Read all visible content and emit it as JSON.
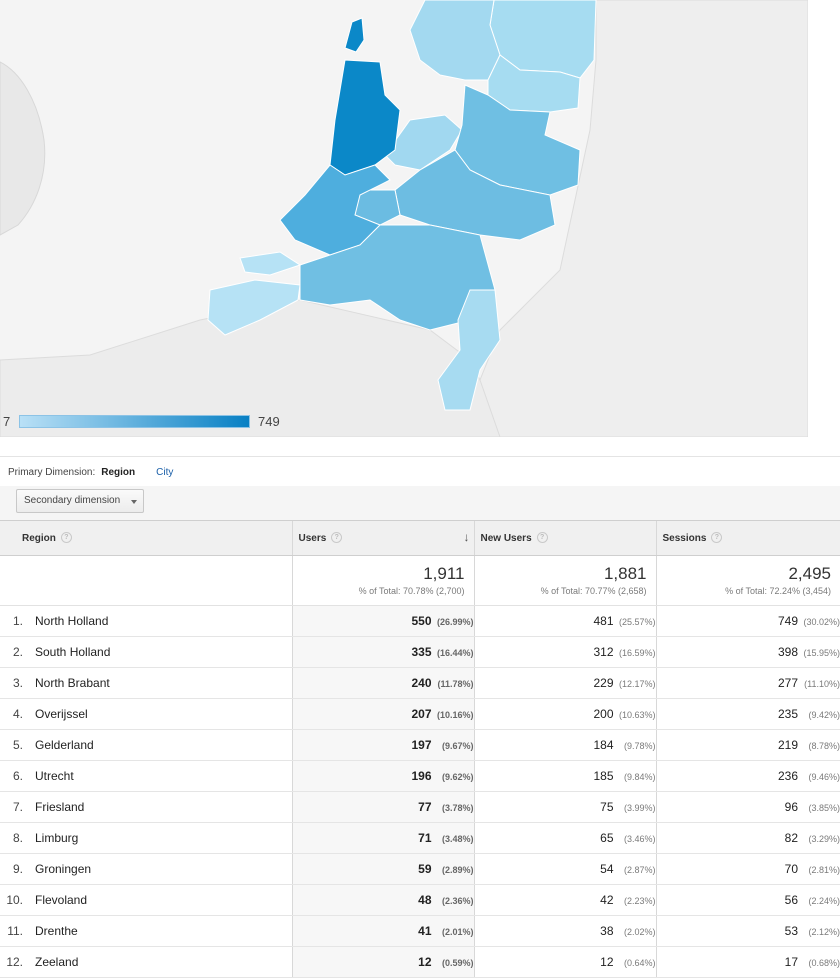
{
  "map": {
    "legend_min": "7",
    "legend_max": "749",
    "color_low": "#b9e0f6",
    "color_high": "#0880c4"
  },
  "dimension": {
    "label": "Primary Dimension:",
    "active": "Region",
    "other": "City",
    "secondary_button": "Secondary dimension"
  },
  "columns": {
    "region": "Region",
    "users": "Users",
    "new_users": "New Users",
    "sessions": "Sessions"
  },
  "totals": {
    "users": {
      "value": "1,911",
      "sub": "% of Total: 70.78% (2,700)"
    },
    "new_users": {
      "value": "1,881",
      "sub": "% of Total: 70.77% (2,658)"
    },
    "sessions": {
      "value": "2,495",
      "sub": "% of Total: 72.24% (3,454)"
    }
  },
  "rows": [
    {
      "n": "1.",
      "region": "North Holland",
      "users": "550",
      "users_pct": "(26.99%)",
      "new_users": "481",
      "new_users_pct": "(25.57%)",
      "sessions": "749",
      "sessions_pct": "(30.02%)"
    },
    {
      "n": "2.",
      "region": "South Holland",
      "users": "335",
      "users_pct": "(16.44%)",
      "new_users": "312",
      "new_users_pct": "(16.59%)",
      "sessions": "398",
      "sessions_pct": "(15.95%)"
    },
    {
      "n": "3.",
      "region": "North Brabant",
      "users": "240",
      "users_pct": "(11.78%)",
      "new_users": "229",
      "new_users_pct": "(12.17%)",
      "sessions": "277",
      "sessions_pct": "(11.10%)"
    },
    {
      "n": "4.",
      "region": "Overijssel",
      "users": "207",
      "users_pct": "(10.16%)",
      "new_users": "200",
      "new_users_pct": "(10.63%)",
      "sessions": "235",
      "sessions_pct": "(9.42%)"
    },
    {
      "n": "5.",
      "region": "Gelderland",
      "users": "197",
      "users_pct": "(9.67%)",
      "new_users": "184",
      "new_users_pct": "(9.78%)",
      "sessions": "219",
      "sessions_pct": "(8.78%)"
    },
    {
      "n": "6.",
      "region": "Utrecht",
      "users": "196",
      "users_pct": "(9.62%)",
      "new_users": "185",
      "new_users_pct": "(9.84%)",
      "sessions": "236",
      "sessions_pct": "(9.46%)"
    },
    {
      "n": "7.",
      "region": "Friesland",
      "users": "77",
      "users_pct": "(3.78%)",
      "new_users": "75",
      "new_users_pct": "(3.99%)",
      "sessions": "96",
      "sessions_pct": "(3.85%)"
    },
    {
      "n": "8.",
      "region": "Limburg",
      "users": "71",
      "users_pct": "(3.48%)",
      "new_users": "65",
      "new_users_pct": "(3.46%)",
      "sessions": "82",
      "sessions_pct": "(3.29%)"
    },
    {
      "n": "9.",
      "region": "Groningen",
      "users": "59",
      "users_pct": "(2.89%)",
      "new_users": "54",
      "new_users_pct": "(2.87%)",
      "sessions": "70",
      "sessions_pct": "(2.81%)"
    },
    {
      "n": "10.",
      "region": "Flevoland",
      "users": "48",
      "users_pct": "(2.36%)",
      "new_users": "42",
      "new_users_pct": "(2.23%)",
      "sessions": "56",
      "sessions_pct": "(2.24%)"
    },
    {
      "n": "11.",
      "region": "Drenthe",
      "users": "41",
      "users_pct": "(2.01%)",
      "new_users": "38",
      "new_users_pct": "(2.02%)",
      "sessions": "53",
      "sessions_pct": "(2.12%)"
    },
    {
      "n": "12.",
      "region": "Zeeland",
      "users": "12",
      "users_pct": "(0.59%)",
      "new_users": "12",
      "new_users_pct": "(0.64%)",
      "sessions": "17",
      "sessions_pct": "(0.68%)"
    }
  ]
}
